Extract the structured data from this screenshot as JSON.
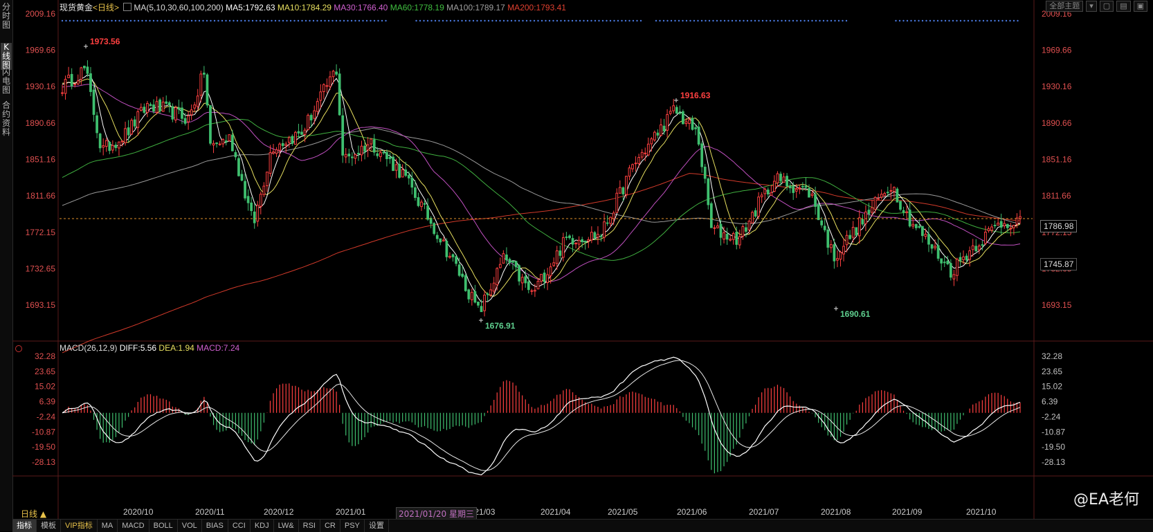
{
  "left_tabs": [
    {
      "label": "分时图",
      "active": false
    },
    {
      "label": "K线图",
      "active": true
    },
    {
      "label": "闪电图",
      "active": false
    },
    {
      "label": "合约资料",
      "active": false
    }
  ],
  "header": {
    "title": "现货黄金",
    "period": "<日线>",
    "ma_label": "MA(5,10,30,60,100,200)",
    "ma5": "MA5:1792.63",
    "ma10": "MA10:1784.29",
    "ma30": "MA30:1766.40",
    "ma60": "MA60:1778.19",
    "ma100": "MA100:1789.17",
    "ma200": "MA200:1793.41",
    "theme_button": "全部主题"
  },
  "macd_header": {
    "label": "MACD(26,12,9)",
    "diff": "DIFF:5.56",
    "dea": "DEA:1.94",
    "macd": "MACD:7.24"
  },
  "colors": {
    "up": "#ff4040",
    "down": "#3fbf6f",
    "ma5": "#ffffff",
    "ma10": "#e8e060",
    "ma30": "#c050c0",
    "ma60": "#40b040",
    "ma100": "#9a9a9a",
    "ma200": "#d23a2a",
    "price_axis": "#e05050",
    "macd_axis": "#c0c0c0"
  },
  "price_axis_labels": [
    "2009.16",
    "1969.66",
    "1930.16",
    "1890.66",
    "1851.16",
    "1811.66",
    "1772.15",
    "1732.65",
    "1693.15"
  ],
  "macd_axis_labels": [
    "32.28",
    "23.65",
    "15.02",
    "6.39",
    "-2.24",
    "-10.87",
    "-19.50",
    "-28.13"
  ],
  "current_price": "1786.98",
  "marker_price": "1745.87",
  "x_labels": [
    "2020/10",
    "2020/11",
    "2020/12",
    "2021/01",
    "2021/03",
    "2021/04",
    "2021/05",
    "2021/06",
    "2021/07",
    "2021/08",
    "2021/09",
    "2021/10"
  ],
  "cursor_date": "2021/01/20 星期三",
  "day_tab": "日线 ▲",
  "bottom_tabs": [
    {
      "label": "指标",
      "active": true,
      "vip": false
    },
    {
      "label": "模板",
      "active": false,
      "vip": false
    },
    {
      "label": "VIP指标",
      "active": false,
      "vip": true
    },
    {
      "label": "MA",
      "active": false,
      "vip": false
    },
    {
      "label": "MACD",
      "active": false,
      "vip": false
    },
    {
      "label": "BOLL",
      "active": false,
      "vip": false
    },
    {
      "label": "VOL",
      "active": false,
      "vip": false
    },
    {
      "label": "BIAS",
      "active": false,
      "vip": false
    },
    {
      "label": "CCI",
      "active": false,
      "vip": false
    },
    {
      "label": "KDJ",
      "active": false,
      "vip": false
    },
    {
      "label": "LW&",
      "active": false,
      "vip": false
    },
    {
      "label": "RSI",
      "active": false,
      "vip": false
    },
    {
      "label": "CR",
      "active": false,
      "vip": false
    },
    {
      "label": "PSY",
      "active": false,
      "vip": false
    },
    {
      "label": "设置",
      "active": false,
      "vip": false
    }
  ],
  "watermark": "@EA老何",
  "chart_data": {
    "type": "candlestick",
    "title": "现货黄金 日线",
    "ylim": [
      1676.91,
      2009.16
    ],
    "annotations": [
      {
        "label": "1973.56",
        "date": "2020/09/18",
        "value": 1973.56,
        "kind": "high"
      },
      {
        "label": "1916.63",
        "date": "2021/06/01",
        "value": 1916.63,
        "kind": "high"
      },
      {
        "label": "1676.91",
        "date": "2021/03/08",
        "value": 1676.91,
        "kind": "low"
      },
      {
        "label": "1690.61",
        "date": "2021/08/09",
        "value": 1690.61,
        "kind": "low"
      }
    ],
    "close_path": [
      {
        "date": "2020/09/08",
        "close": 1930
      },
      {
        "date": "2020/09/18",
        "close": 1950
      },
      {
        "date": "2020/09/25",
        "close": 1860
      },
      {
        "date": "2020/10/06",
        "close": 1880
      },
      {
        "date": "2020/10/15",
        "close": 1910
      },
      {
        "date": "2020/10/23",
        "close": 1905
      },
      {
        "date": "2020/11/02",
        "close": 1895
      },
      {
        "date": "2020/11/09",
        "close": 1950
      },
      {
        "date": "2020/11/11",
        "close": 1865
      },
      {
        "date": "2020/11/20",
        "close": 1875
      },
      {
        "date": "2020/11/30",
        "close": 1780
      },
      {
        "date": "2020/12/08",
        "close": 1865
      },
      {
        "date": "2020/12/21",
        "close": 1880
      },
      {
        "date": "2021/01/05",
        "close": 1950
      },
      {
        "date": "2021/01/08",
        "close": 1850
      },
      {
        "date": "2021/01/20",
        "close": 1870
      },
      {
        "date": "2021/02/03",
        "close": 1835
      },
      {
        "date": "2021/02/17",
        "close": 1775
      },
      {
        "date": "2021/02/26",
        "close": 1735
      },
      {
        "date": "2021/03/08",
        "close": 1685
      },
      {
        "date": "2021/03/19",
        "close": 1745
      },
      {
        "date": "2021/03/31",
        "close": 1705
      },
      {
        "date": "2021/04/15",
        "close": 1765
      },
      {
        "date": "2021/04/30",
        "close": 1770
      },
      {
        "date": "2021/05/14",
        "close": 1845
      },
      {
        "date": "2021/06/01",
        "close": 1905
      },
      {
        "date": "2021/06/11",
        "close": 1878
      },
      {
        "date": "2021/06/17",
        "close": 1775
      },
      {
        "date": "2021/06/29",
        "close": 1765
      },
      {
        "date": "2021/07/09",
        "close": 1810
      },
      {
        "date": "2021/07/15",
        "close": 1830
      },
      {
        "date": "2021/07/30",
        "close": 1815
      },
      {
        "date": "2021/08/09",
        "close": 1745
      },
      {
        "date": "2021/08/20",
        "close": 1780
      },
      {
        "date": "2021/09/03",
        "close": 1825
      },
      {
        "date": "2021/09/10",
        "close": 1790
      },
      {
        "date": "2021/09/29",
        "close": 1730
      },
      {
        "date": "2021/10/08",
        "close": 1755
      },
      {
        "date": "2021/10/20",
        "close": 1782
      },
      {
        "date": "2021/10/29",
        "close": 1785
      }
    ],
    "moving_averages": [
      "MA5",
      "MA10",
      "MA30",
      "MA60",
      "MA100",
      "MA200"
    ],
    "macd": {
      "diff": 5.56,
      "dea": 1.94,
      "macd": 7.24,
      "ylim": [
        -28.13,
        32.28
      ]
    }
  }
}
